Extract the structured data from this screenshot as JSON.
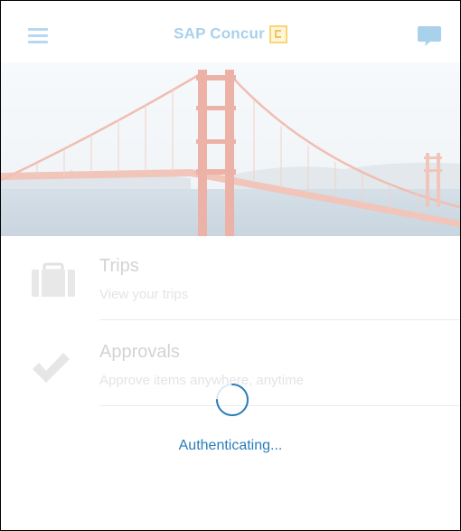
{
  "header": {
    "app_title": "SAP Concur",
    "logo_letter": "C",
    "menu_icon": "hamburger-menu-icon",
    "chat_icon": "chat-bubble-icon"
  },
  "hero": {
    "image_subject": "golden-gate-bridge"
  },
  "menu": {
    "items": [
      {
        "title": "Trips",
        "subtitle": "View your trips",
        "icon": "briefcase-icon"
      },
      {
        "title": "Approvals",
        "subtitle": "Approve items anywhere, anytime",
        "icon": "checkmark-icon"
      }
    ]
  },
  "status": {
    "message": "Authenticating...",
    "spinner_icon": "loading-spinner-icon"
  },
  "colors": {
    "accent": "#2a7db8",
    "header_faded": "#a9d1ec",
    "logo": "#f4c35a",
    "bridge": "#e8907a"
  }
}
